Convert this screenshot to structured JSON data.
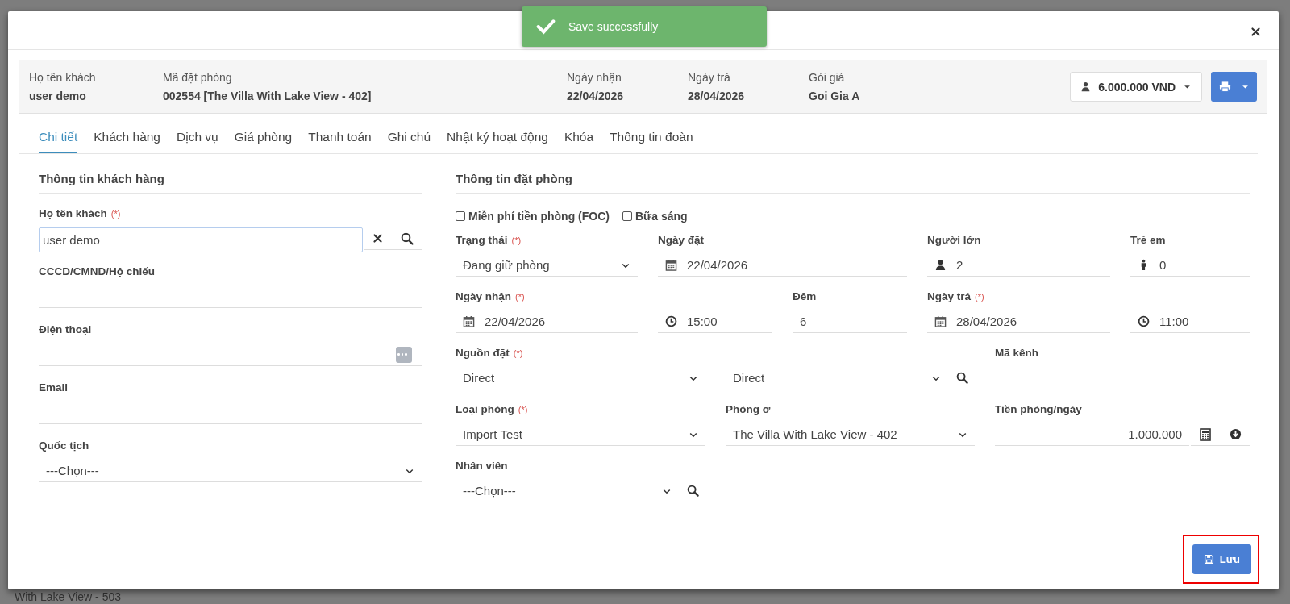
{
  "background": {
    "fragment": "With Lake View - 503"
  },
  "toast": {
    "message": "Save successfully"
  },
  "summary": {
    "items": [
      {
        "label": "Họ tên khách",
        "value": "user demo"
      },
      {
        "label": "Mã đặt phòng",
        "value": "002554 [The Villa With Lake View - 402]"
      },
      {
        "label": "Ngày nhận",
        "value": "22/04/2026"
      },
      {
        "label": "Ngày trả",
        "value": "28/04/2026"
      },
      {
        "label": "Gói giá",
        "value": "Goi Gia A"
      }
    ],
    "amount_button": "6.000.000 VND"
  },
  "tabs": [
    {
      "label": "Chi tiết",
      "selected": true
    },
    {
      "label": "Khách hàng",
      "selected": false
    },
    {
      "label": "Dịch vụ",
      "selected": false
    },
    {
      "label": "Giá phòng",
      "selected": false
    },
    {
      "label": "Thanh toán",
      "selected": false
    },
    {
      "label": "Ghi chú",
      "selected": false
    },
    {
      "label": "Nhật ký hoạt động",
      "selected": false
    },
    {
      "label": "Khóa",
      "selected": false
    },
    {
      "label": "Thông tin đoàn",
      "selected": false
    }
  ],
  "guest_panel": {
    "heading": "Thông tin khách hàng",
    "fields": [
      {
        "kind": "lookup",
        "label": "Họ tên khách",
        "note": "(*)",
        "value": "user demo"
      },
      {
        "kind": "text",
        "label": "CCCD/CMND/Hộ chiếu"
      },
      {
        "kind": "phone",
        "label": "Điện thoại"
      },
      {
        "kind": "text",
        "label": "Email"
      },
      {
        "kind": "select",
        "label": "Quốc tịch",
        "value": "---Chọn---"
      }
    ]
  },
  "booking_panel": {
    "heading": "Thông tin đặt phòng",
    "options": [
      {
        "label": "Miễn phí tiền phòng (FOC)",
        "checked": false
      },
      {
        "label": "Bữa sáng",
        "checked": false
      }
    ],
    "fields": [
      {
        "kind": "select",
        "label": "Trạng thái",
        "note": "(*)",
        "value": "Đang giữ phòng"
      },
      {
        "kind": "date",
        "label": "Ngày đặt",
        "value": "22/04/2026"
      },
      {
        "kind": "adults",
        "label": "Người lớn",
        "value": "2"
      },
      {
        "kind": "children",
        "label": "Trẻ em",
        "value": "0"
      },
      {
        "kind": "date",
        "label": "Ngày nhận",
        "note": "(*)",
        "value": "22/04/2026"
      },
      {
        "kind": "time",
        "value": "15:00"
      },
      {
        "kind": "text",
        "label": "Đêm",
        "value": "6"
      },
      {
        "kind": "date",
        "label": "Ngày trả",
        "note": "(*)",
        "value": "28/04/2026"
      },
      {
        "kind": "time",
        "value": "11:00"
      },
      {
        "kind": "select",
        "label": "Nguồn đặt",
        "note": "(*)",
        "value": "Direct"
      },
      {
        "kind": "select-search",
        "value": "Direct"
      },
      {
        "kind": "text",
        "label": "Mã kênh"
      },
      {
        "kind": "select",
        "label": "Loại phòng",
        "note": "(*)",
        "value": "Import Test"
      },
      {
        "kind": "select",
        "label": "Phòng ở",
        "value": "The Villa With Lake View - 402"
      },
      {
        "kind": "money",
        "label": "Tiền phòng/ngày",
        "value": "1.000.000"
      },
      {
        "kind": "select-search",
        "label": "Nhân viên",
        "value": "---Chọn---"
      }
    ]
  },
  "save_button": "Lưu"
}
